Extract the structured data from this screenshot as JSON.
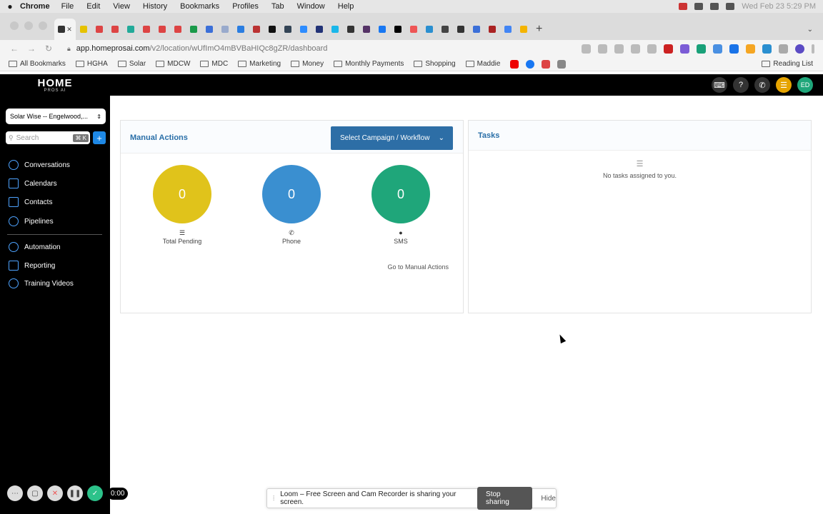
{
  "menubar": {
    "app": "Chrome",
    "items": [
      "File",
      "Edit",
      "View",
      "History",
      "Bookmarks",
      "Profiles",
      "Tab",
      "Window",
      "Help"
    ],
    "datetime": "Wed Feb 23  5:29 PM"
  },
  "browser": {
    "url_host": "app.homeprosai.com",
    "url_path": "/v2/location/wUfImO4mBVBaHIQc8gZR/dashboard",
    "bookmarks": [
      "All Bookmarks",
      "HGHA",
      "Solar",
      "MDCW",
      "MDC",
      "Marketing",
      "Money",
      "Monthly Payments",
      "Shopping",
      "Maddie"
    ],
    "reading_list": "Reading List"
  },
  "app": {
    "logo": "HOME",
    "logo_sub": "PROS AI",
    "avatar_initials": "ED",
    "colors": {
      "accent": "#2d6ea6",
      "pending": "#e0c31b",
      "phone": "#3a8fd0",
      "sms": "#1fa67a",
      "header_text": "#2a6fa8"
    }
  },
  "sidebar": {
    "location": "Solar Wise -- Engelwood,...",
    "search_placeholder": "Search",
    "search_shortcut": "⌘ K",
    "items": [
      {
        "label": "Conversations",
        "icon": "chat-icon"
      },
      {
        "label": "Calendars",
        "icon": "calendar-icon"
      },
      {
        "label": "Contacts",
        "icon": "contacts-icon"
      },
      {
        "label": "Pipelines",
        "icon": "pipeline-icon"
      },
      {
        "label": "Automation",
        "icon": "automation-icon"
      },
      {
        "label": "Reporting",
        "icon": "chart-icon"
      },
      {
        "label": "Training Videos",
        "icon": "video-icon"
      }
    ]
  },
  "manual_actions": {
    "title": "Manual Actions",
    "campaign_select": "Select Campaign / Workflow",
    "stats": [
      {
        "label": "Total Pending",
        "value": "0"
      },
      {
        "label": "Phone",
        "value": "0"
      },
      {
        "label": "SMS",
        "value": "0"
      }
    ],
    "link": "Go to Manual Actions"
  },
  "tasks": {
    "title": "Tasks",
    "empty_text": "No tasks assigned to you."
  },
  "loom": {
    "timer": "0:00",
    "message": "Loom – Free Screen and Cam Recorder is sharing your screen.",
    "stop": "Stop sharing",
    "hide": "Hide"
  }
}
